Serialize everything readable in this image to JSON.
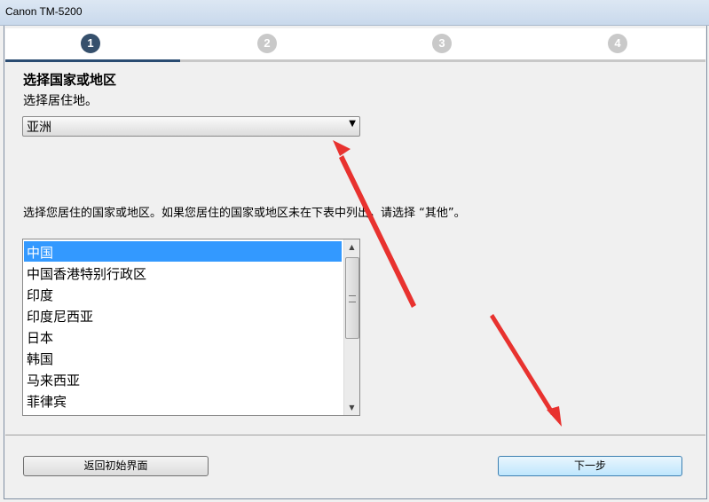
{
  "window": {
    "title": "Canon TM-5200"
  },
  "steps": [
    {
      "number": "1",
      "active": true
    },
    {
      "number": "2",
      "active": false
    },
    {
      "number": "3",
      "active": false
    },
    {
      "number": "4",
      "active": false
    }
  ],
  "region": {
    "heading": "选择国家或地区",
    "subtitle": "选择居住地。",
    "selected": "亚洲"
  },
  "country": {
    "instruction": "选择您居住的国家或地区。如果您居住的国家或地区未在下表中列出，请选择 “其他”。",
    "items": [
      "中国",
      "中国香港特别行政区",
      "印度",
      "印度尼西亚",
      "日本",
      "韩国",
      "马来西亚",
      "菲律宾"
    ],
    "selected_index": 0
  },
  "buttons": {
    "back": "返回初始界面",
    "next": "下一步"
  },
  "colors": {
    "annotation_arrow": "#e8322f",
    "selection": "#3399ff"
  }
}
